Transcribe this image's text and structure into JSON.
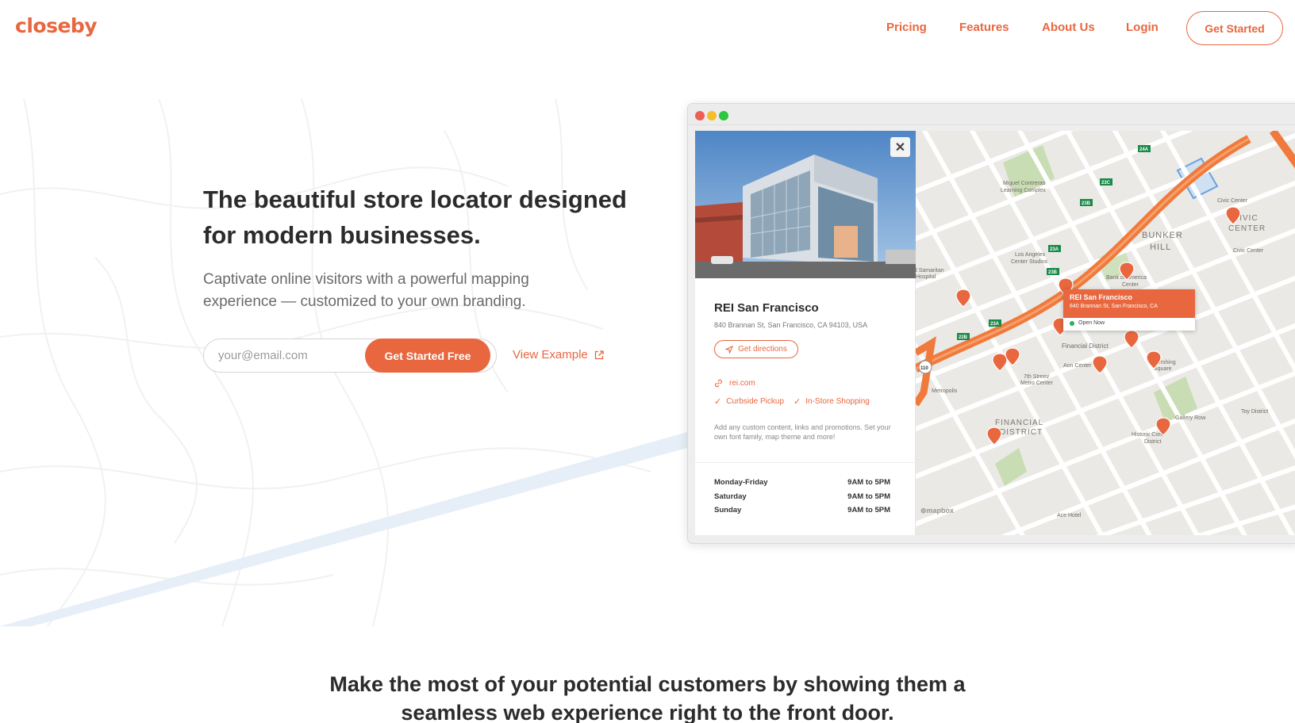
{
  "brand": {
    "logo": "closeby",
    "accent": "#e8673f"
  },
  "nav": {
    "items": [
      {
        "label": "Pricing"
      },
      {
        "label": "Features"
      },
      {
        "label": "About Us"
      },
      {
        "label": "Login"
      }
    ],
    "cta": "Get Started"
  },
  "hero": {
    "headline": "The beautiful store locator designed for modern businesses.",
    "subheadline": "Captivate online visitors with a powerful mapping experience — customized to your own branding.",
    "email_placeholder": "your@email.com",
    "cta": "Get Started Free",
    "secondary_link": "View Example",
    "secondary_icon": "external-link-icon"
  },
  "mockup": {
    "store": {
      "name": "REI San Francisco",
      "address": "840 Brannan St, San Francisco, CA 94103, USA",
      "directions": "Get directions",
      "website": "rei.com",
      "features": [
        "Curbside Pickup",
        "In-Store Shopping"
      ],
      "note": "Add any custom content, links and promotions. Set your own font family, map theme and more!",
      "hours": [
        {
          "day": "Monday-Friday",
          "time": "9AM to 5PM"
        },
        {
          "day": "Saturday",
          "time": "9AM to 5PM"
        },
        {
          "day": "Sunday",
          "time": "9AM to 5PM"
        }
      ]
    },
    "callout": {
      "title": "REI San Francisco",
      "address": "840 Brannan St, San Francisco, CA",
      "status": "Open Now"
    },
    "map_labels": {
      "bunker_hill": "BUNKER HILL",
      "civic_center": "CIVIC CENTER",
      "financial_district": "FINANCIAL DISTRICT",
      "financial_district_small": "Financial District",
      "miguel": "Miguel Contreras Learning Complex",
      "la_center": "Los Angeles Center Studios",
      "bofa": "Bank of America Center",
      "historic": "Historic Core District",
      "gallery_row": "Gallery Row",
      "toy_district": "Toy District",
      "aon": "Aon Center",
      "metro": "7th Street/ Metro Center",
      "pershing": "Pershing Square",
      "metropolis": "Metropolis",
      "ace_hotel": "Ace Hotel",
      "samaritan": "Good Samaritan Hospital",
      "attribution": "mapbox"
    }
  },
  "section": {
    "title_line1": "Make the most of your potential customers by showing them a",
    "title_line2": "seamless web experience right to the front door."
  }
}
